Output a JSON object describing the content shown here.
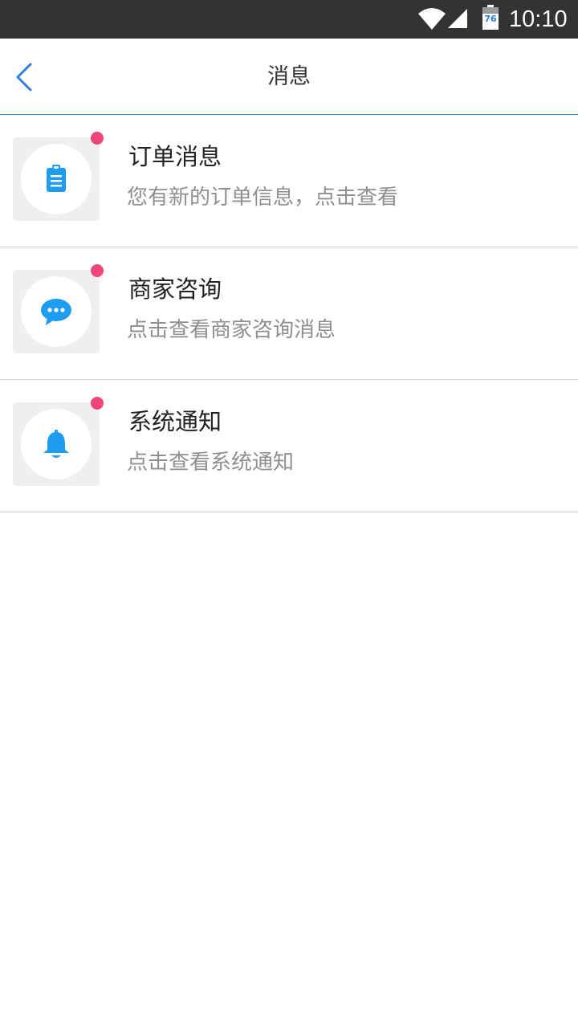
{
  "status_bar": {
    "battery_level": "76",
    "time": "10:10",
    "icons": [
      "wifi-icon",
      "cell-signal-icon",
      "battery-icon"
    ]
  },
  "nav": {
    "back_icon": "chevron-left-icon",
    "title": "消息"
  },
  "messages": [
    {
      "icon": "clipboard-icon",
      "title": "订单消息",
      "desc": "您有新的订单信息，点击查看",
      "unread": true
    },
    {
      "icon": "chat-bubble-icon",
      "title": "商家咨询",
      "desc": "点击查看商家咨询消息",
      "unread": true
    },
    {
      "icon": "bell-icon",
      "title": "系统通知",
      "desc": "点击查看系统通知",
      "unread": true
    }
  ],
  "colors": {
    "accent": "#2a7fd8",
    "icon_blue": "#1e9cf0",
    "unread_dot": "#f0457a",
    "status_bar": "#333333"
  }
}
